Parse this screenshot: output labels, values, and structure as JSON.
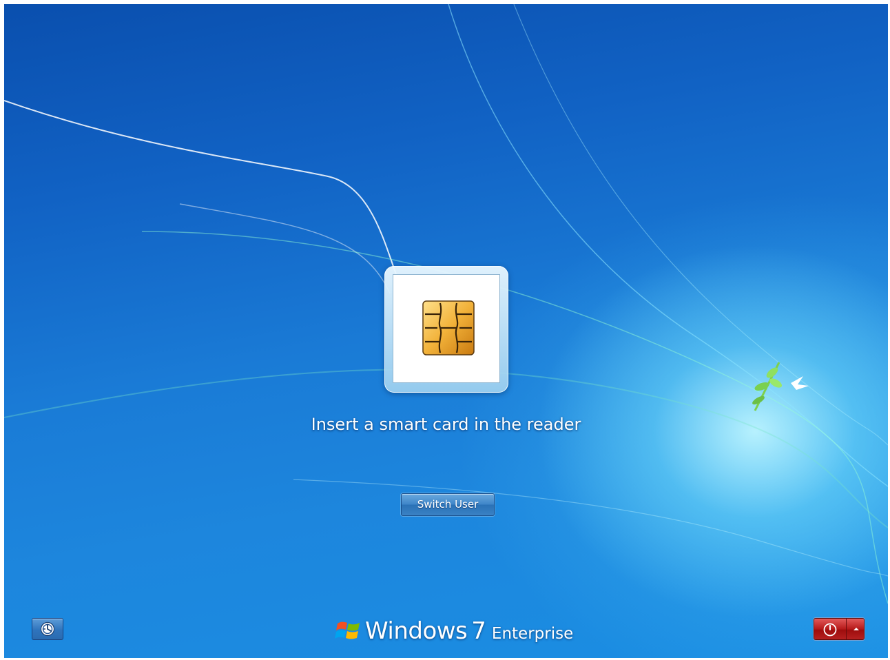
{
  "login": {
    "prompt": "Insert a smart card in the reader",
    "switch_user_label": "Switch User"
  },
  "branding": {
    "product": "Windows",
    "version": "7",
    "edition": "Enterprise"
  },
  "icons": {
    "smart_card": "smart-card-chip-icon",
    "ease_of_access": "ease-of-access-icon",
    "power": "power-icon",
    "options_arrow": "chevron-up-icon",
    "logo": "windows-flag-logo"
  },
  "colors": {
    "background": "#1a7bd6",
    "power_button": "#b71a1a",
    "switch_button": "#3f86c9"
  }
}
